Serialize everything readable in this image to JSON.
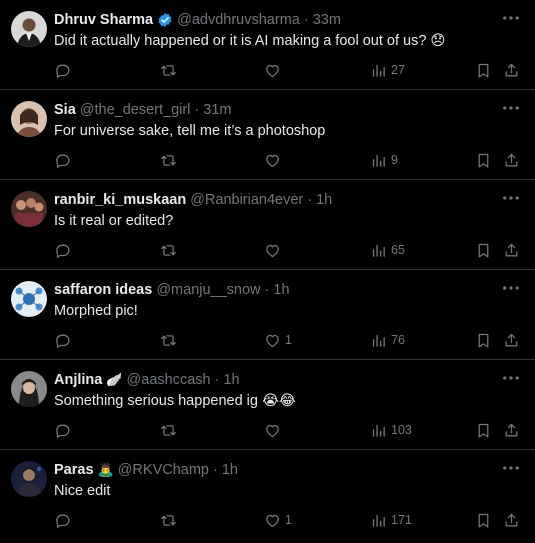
{
  "replies": [
    {
      "name": "Dhruv Sharma",
      "verified": true,
      "handle": "@advdhruvsharma",
      "time": "33m",
      "text": "Did it actually happened or it is AI making a fool out of us? 😞",
      "likes": "",
      "views": "27",
      "avatar": "person-suit"
    },
    {
      "name": "Sia",
      "handle": "@the_desert_girl",
      "time": "31m",
      "text": "For universe sake, tell me it’s a photoshop",
      "likes": "",
      "views": "9",
      "avatar": "sketch-portrait"
    },
    {
      "name": "ranbir_ki_muskaan",
      "handle": "@Ranbirian4ever",
      "time": "1h",
      "text": "Is it real or edited?",
      "likes": "",
      "views": "65",
      "avatar": "group-photo"
    },
    {
      "name": "saffaron ideas",
      "handle": "@manju__snow",
      "time": "1h",
      "text": "Morphed pic!",
      "likes": "1",
      "views": "76",
      "avatar": "icons-graphic"
    },
    {
      "name": "Anjlina",
      "name_emoji": "🪽",
      "handle": "@aashccash",
      "time": "1h",
      "text": "Something serious happened ig 😭😂",
      "likes": "",
      "views": "103",
      "avatar": "woman-portrait"
    },
    {
      "name": "Paras",
      "name_emoji": "🙇‍♂️",
      "handle": "@RKVChamp",
      "time": "1h",
      "text": "Nice edit",
      "likes": "1",
      "views": "171",
      "avatar": "man-dark"
    }
  ],
  "colors": {
    "background": "#000000",
    "text": "#e7e9ea",
    "secondary": "#71767b",
    "divider": "#2f3336",
    "verified": "#1d9bf0"
  },
  "icons": [
    "reply-icon",
    "retweet-icon",
    "like-icon",
    "views-icon",
    "bookmark-icon",
    "share-icon",
    "more-icon",
    "verified-badge-icon"
  ]
}
